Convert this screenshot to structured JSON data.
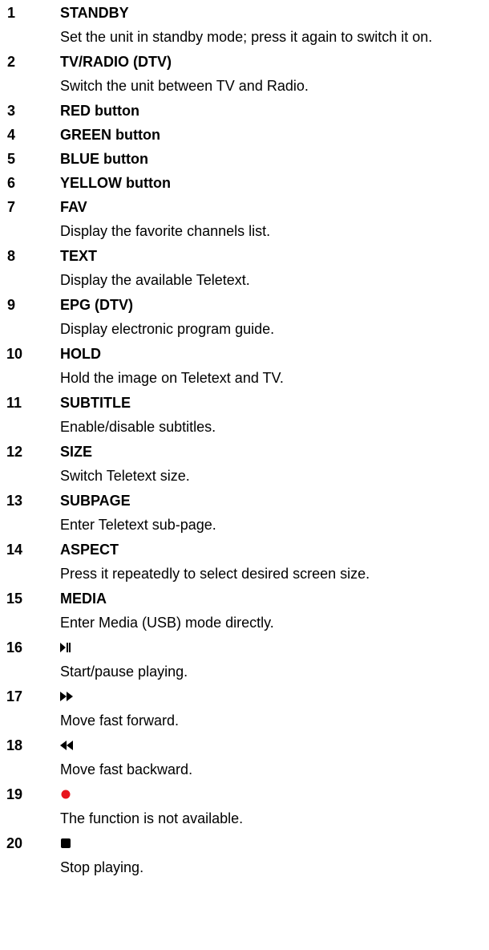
{
  "items": [
    {
      "num": "1",
      "title": "STANDBY",
      "desc": "Set the unit in standby mode; press it again to switch it on."
    },
    {
      "num": "2",
      "title": "TV/RADIO (DTV)",
      "desc": "Switch the unit between TV and Radio."
    },
    {
      "num": "3",
      "title": "RED button"
    },
    {
      "num": "4",
      "title": "GREEN button"
    },
    {
      "num": "5",
      "title": "BLUE button"
    },
    {
      "num": "6",
      "title": "YELLOW button"
    },
    {
      "num": "7",
      "title": "FAV",
      "desc": "Display the favorite channels list."
    },
    {
      "num": "8",
      "title": "TEXT",
      "desc": "Display the available Teletext."
    },
    {
      "num": "9",
      "title": "EPG (DTV)",
      "desc": "Display electronic program guide."
    },
    {
      "num": "10",
      "title": "HOLD",
      "desc": "Hold the image on Teletext and TV."
    },
    {
      "num": "11",
      "title": "SUBTITLE",
      "desc": "Enable/disable subtitles."
    },
    {
      "num": "12",
      "title": "SIZE",
      "desc": "Switch Teletext size."
    },
    {
      "num": "13",
      "title": "SUBPAGE",
      "desc": "Enter Teletext sub-page."
    },
    {
      "num": "14",
      "title": "ASPECT",
      "desc": "Press it repeatedly to select desired screen size."
    },
    {
      "num": "15",
      "title": "MEDIA",
      "desc": "Enter Media (USB) mode directly."
    },
    {
      "num": "16",
      "icon": "play-pause-icon",
      "desc": "Start/pause playing."
    },
    {
      "num": "17",
      "icon": "fast-forward-icon",
      "desc": "Move fast forward."
    },
    {
      "num": "18",
      "icon": "fast-backward-icon",
      "desc": "Move fast backward."
    },
    {
      "num": "19",
      "icon": "record-icon",
      "desc": "The function is not available.",
      "icon_color": "#e8141c"
    },
    {
      "num": "20",
      "icon": "stop-icon",
      "desc": "Stop playing."
    }
  ]
}
